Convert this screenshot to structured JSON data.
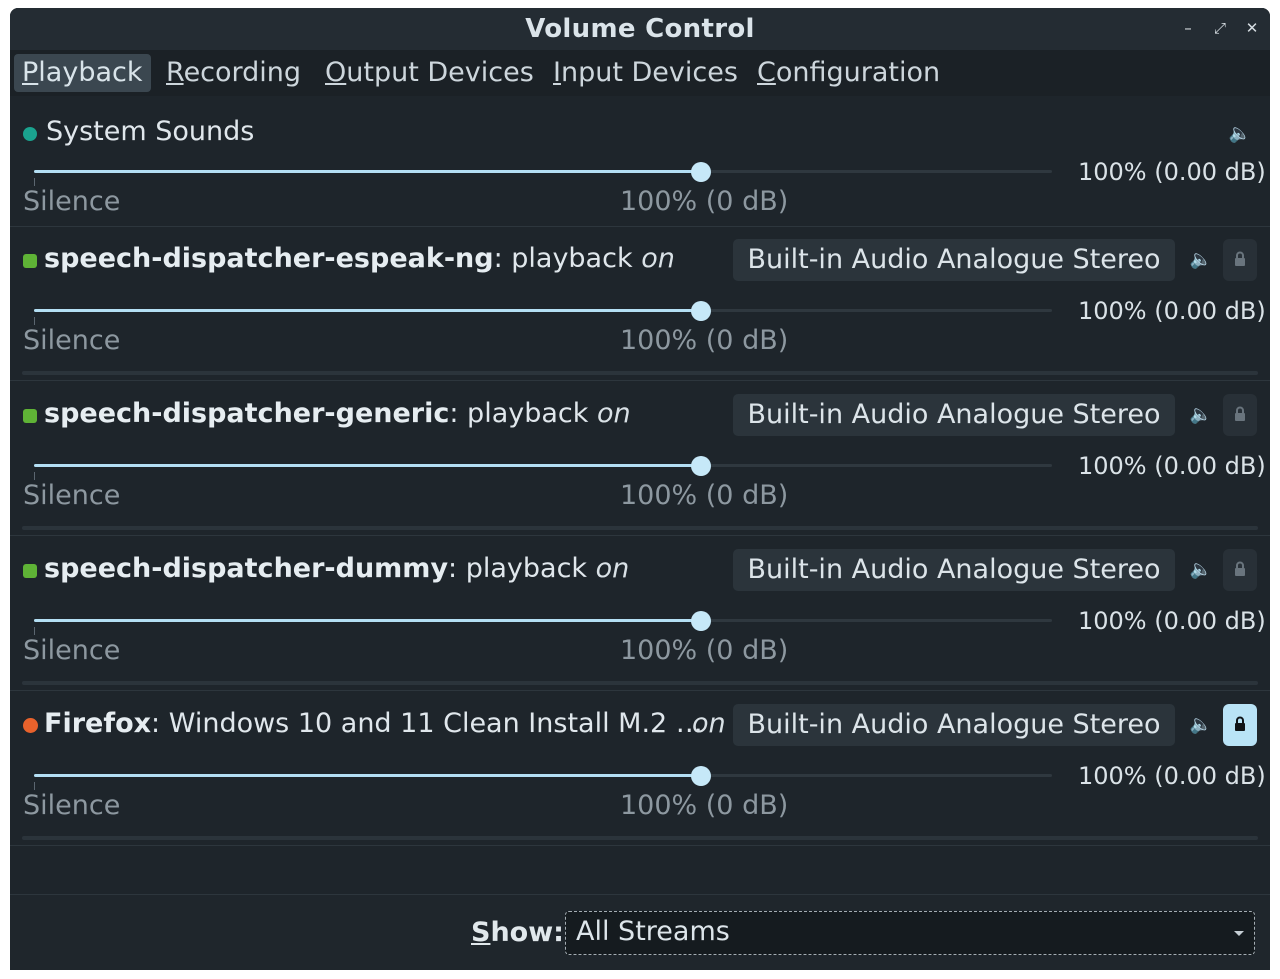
{
  "window": {
    "title": "Volume Control"
  },
  "titlebar_buttons": {
    "minimize": "–",
    "maximize": "⤢",
    "close": "✕"
  },
  "tabs": [
    {
      "prefix": "",
      "u": "P",
      "rest": "layback",
      "active": true
    },
    {
      "prefix": "",
      "u": "R",
      "rest": "ecording",
      "active": false
    },
    {
      "prefix": "",
      "u": "O",
      "rest": "utput Devices",
      "active": false
    },
    {
      "prefix": "",
      "u": "I",
      "rest": "nput Devices",
      "active": false
    },
    {
      "prefix": "",
      "u": "C",
      "rest": "onfiguration",
      "active": false
    }
  ],
  "system_sounds": {
    "name": "System Sounds",
    "volume_label": "100% (0.00 dB)",
    "volume_fraction": 1.0,
    "silence_label": "Silence",
    "hundred_label": "100% (0 dB)"
  },
  "streams": [
    {
      "app": "speech-dispatcher-espeak-ng",
      "sep": ": playback",
      "on": "on",
      "device": "Built-in Audio Analogue Stereo",
      "volume_label": "100% (0.00 dB)",
      "silence_label": "Silence",
      "hundred_label": "100% (0 dB)",
      "locked": false,
      "icon_color": "#5fb336"
    },
    {
      "app": "speech-dispatcher-generic",
      "sep": ": playback",
      "on": "on",
      "device": "Built-in Audio Analogue Stereo",
      "volume_label": "100% (0.00 dB)",
      "silence_label": "Silence",
      "hundred_label": "100% (0 dB)",
      "locked": false,
      "icon_color": "#5fb336"
    },
    {
      "app": "speech-dispatcher-dummy",
      "sep": ": playback",
      "on": "on",
      "device": "Built-in Audio Analogue Stereo",
      "volume_label": "100% (0.00 dB)",
      "silence_label": "Silence",
      "hundred_label": "100% (0 dB)",
      "locked": false,
      "icon_color": "#5fb336"
    },
    {
      "app": "Firefox",
      "sep": ": Windows 10 and 11 Clean Install M.2 …",
      "on": "on",
      "device": "Built-in Audio Analogue Stereo",
      "volume_label": "100% (0.00 dB)",
      "silence_label": "Silence",
      "hundred_label": "100% (0 dB)",
      "locked": true,
      "icon_color": "#e8622c"
    }
  ],
  "footer": {
    "show_u": "S",
    "show_rest": "how:",
    "filter_value": "All Streams"
  },
  "colors": {
    "accent": "#b4dff4",
    "background": "#1e252b"
  }
}
